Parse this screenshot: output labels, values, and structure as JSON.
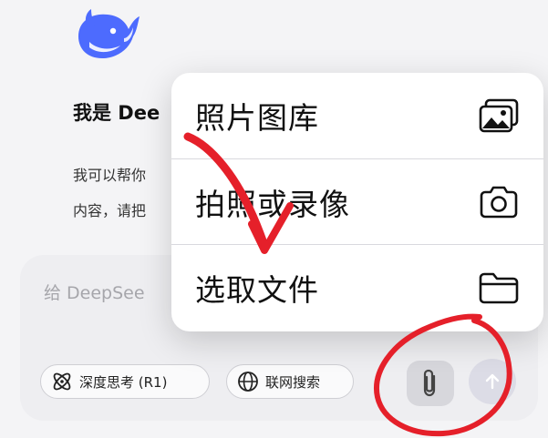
{
  "app": {
    "greeting_title": "我是 Dee",
    "greeting_line1": "我可以帮你",
    "greeting_line2": "内容，请把"
  },
  "composer": {
    "placeholder": "给 DeepSee",
    "deep_think_label": "深度思考 (R1)",
    "web_search_label": "联网搜索"
  },
  "menu": {
    "items": [
      {
        "label": "照片图库",
        "icon": "photo-library-icon"
      },
      {
        "label": "拍照或录像",
        "icon": "camera-icon"
      },
      {
        "label": "选取文件",
        "icon": "folder-icon"
      }
    ]
  },
  "colors": {
    "brand": "#4d6bfe",
    "annotation": "#e5202a",
    "menu_bg": "#ffffff",
    "page_bg": "#f4f4f6"
  }
}
